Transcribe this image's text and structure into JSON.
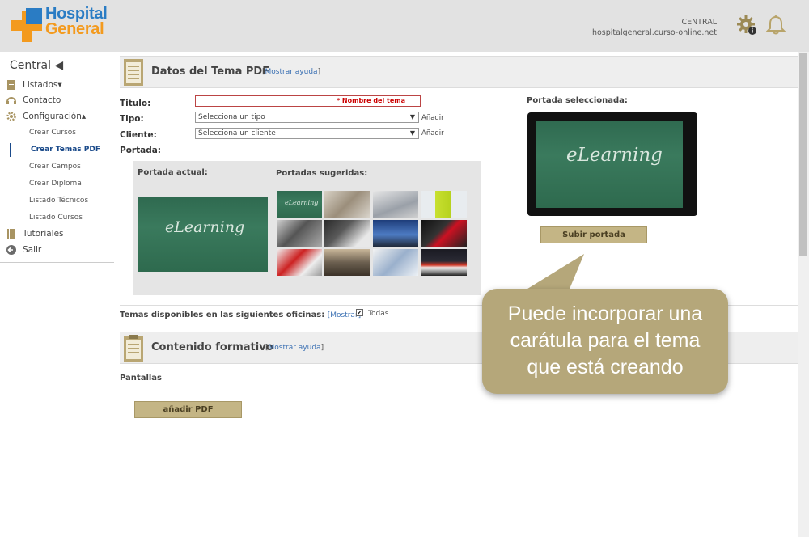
{
  "header": {
    "logo_line1": "Hospital",
    "logo_line2": "General",
    "account_name": "CENTRAL",
    "account_domain": "hospitalgeneral.curso-online.net"
  },
  "sidebar": {
    "title": "Central ◀",
    "items": [
      {
        "label": "Listados▾",
        "icon": "list-icon"
      },
      {
        "label": "Contacto",
        "icon": "headset-icon"
      },
      {
        "label": "Configuración▴",
        "icon": "gear-icon"
      }
    ],
    "subitems": [
      "Crear Cursos",
      "Crear Temas PDF",
      "Crear Campos",
      "Crear Diploma",
      "Listado Técnicos",
      "Listado Cursos"
    ],
    "active_subitem": "Crear Temas PDF",
    "bottom_items": [
      {
        "label": "Tutoriales",
        "icon": "book-icon"
      },
      {
        "label": "Salir",
        "icon": "exit-icon"
      }
    ]
  },
  "datos": {
    "title": "Datos del Tema PDF",
    "help_open": "[",
    "help_link": "Mostrar ayuda",
    "help_close": "]",
    "titulo_label": "Titulo:",
    "titulo_placeholder": "* Nombre del tema",
    "tipo_label": "Tipo:",
    "tipo_value": "Selecciona un tipo",
    "cliente_label": "Cliente:",
    "cliente_value": "Selecciona un cliente",
    "anadir": "Añadir",
    "portada_label": "Portada:",
    "portada_actual_label": "Portada actual:",
    "portadas_sugeridas_label": "Portadas sugeridas:",
    "portada_board_text": "eLearning",
    "portada_seleccionada_label": "Portada seleccionada:",
    "subir_portada": "Subir portada"
  },
  "temas": {
    "label": "Temas disponibles en las siguientes oficinas:",
    "link": "Mostrar",
    "todas": "Todas",
    "checked": true
  },
  "contenido": {
    "title": "Contenido formativo",
    "help_open": "[",
    "help_link": "Mostrar ayuda",
    "help_close": "]",
    "pantallas": "Pantallas",
    "add_pdf": "añadir PDF"
  },
  "callout": {
    "line1": "Puede incorporar una",
    "line2": "carátula para el tema",
    "line3": "que está creando"
  },
  "colors": {
    "accent_gold": "#c4b585",
    "callout": "#b5a77a",
    "logo_blue": "#2a7cc4",
    "logo_orange": "#f39a1e",
    "link": "#3d72b4",
    "board_green": "#2f6a50"
  }
}
